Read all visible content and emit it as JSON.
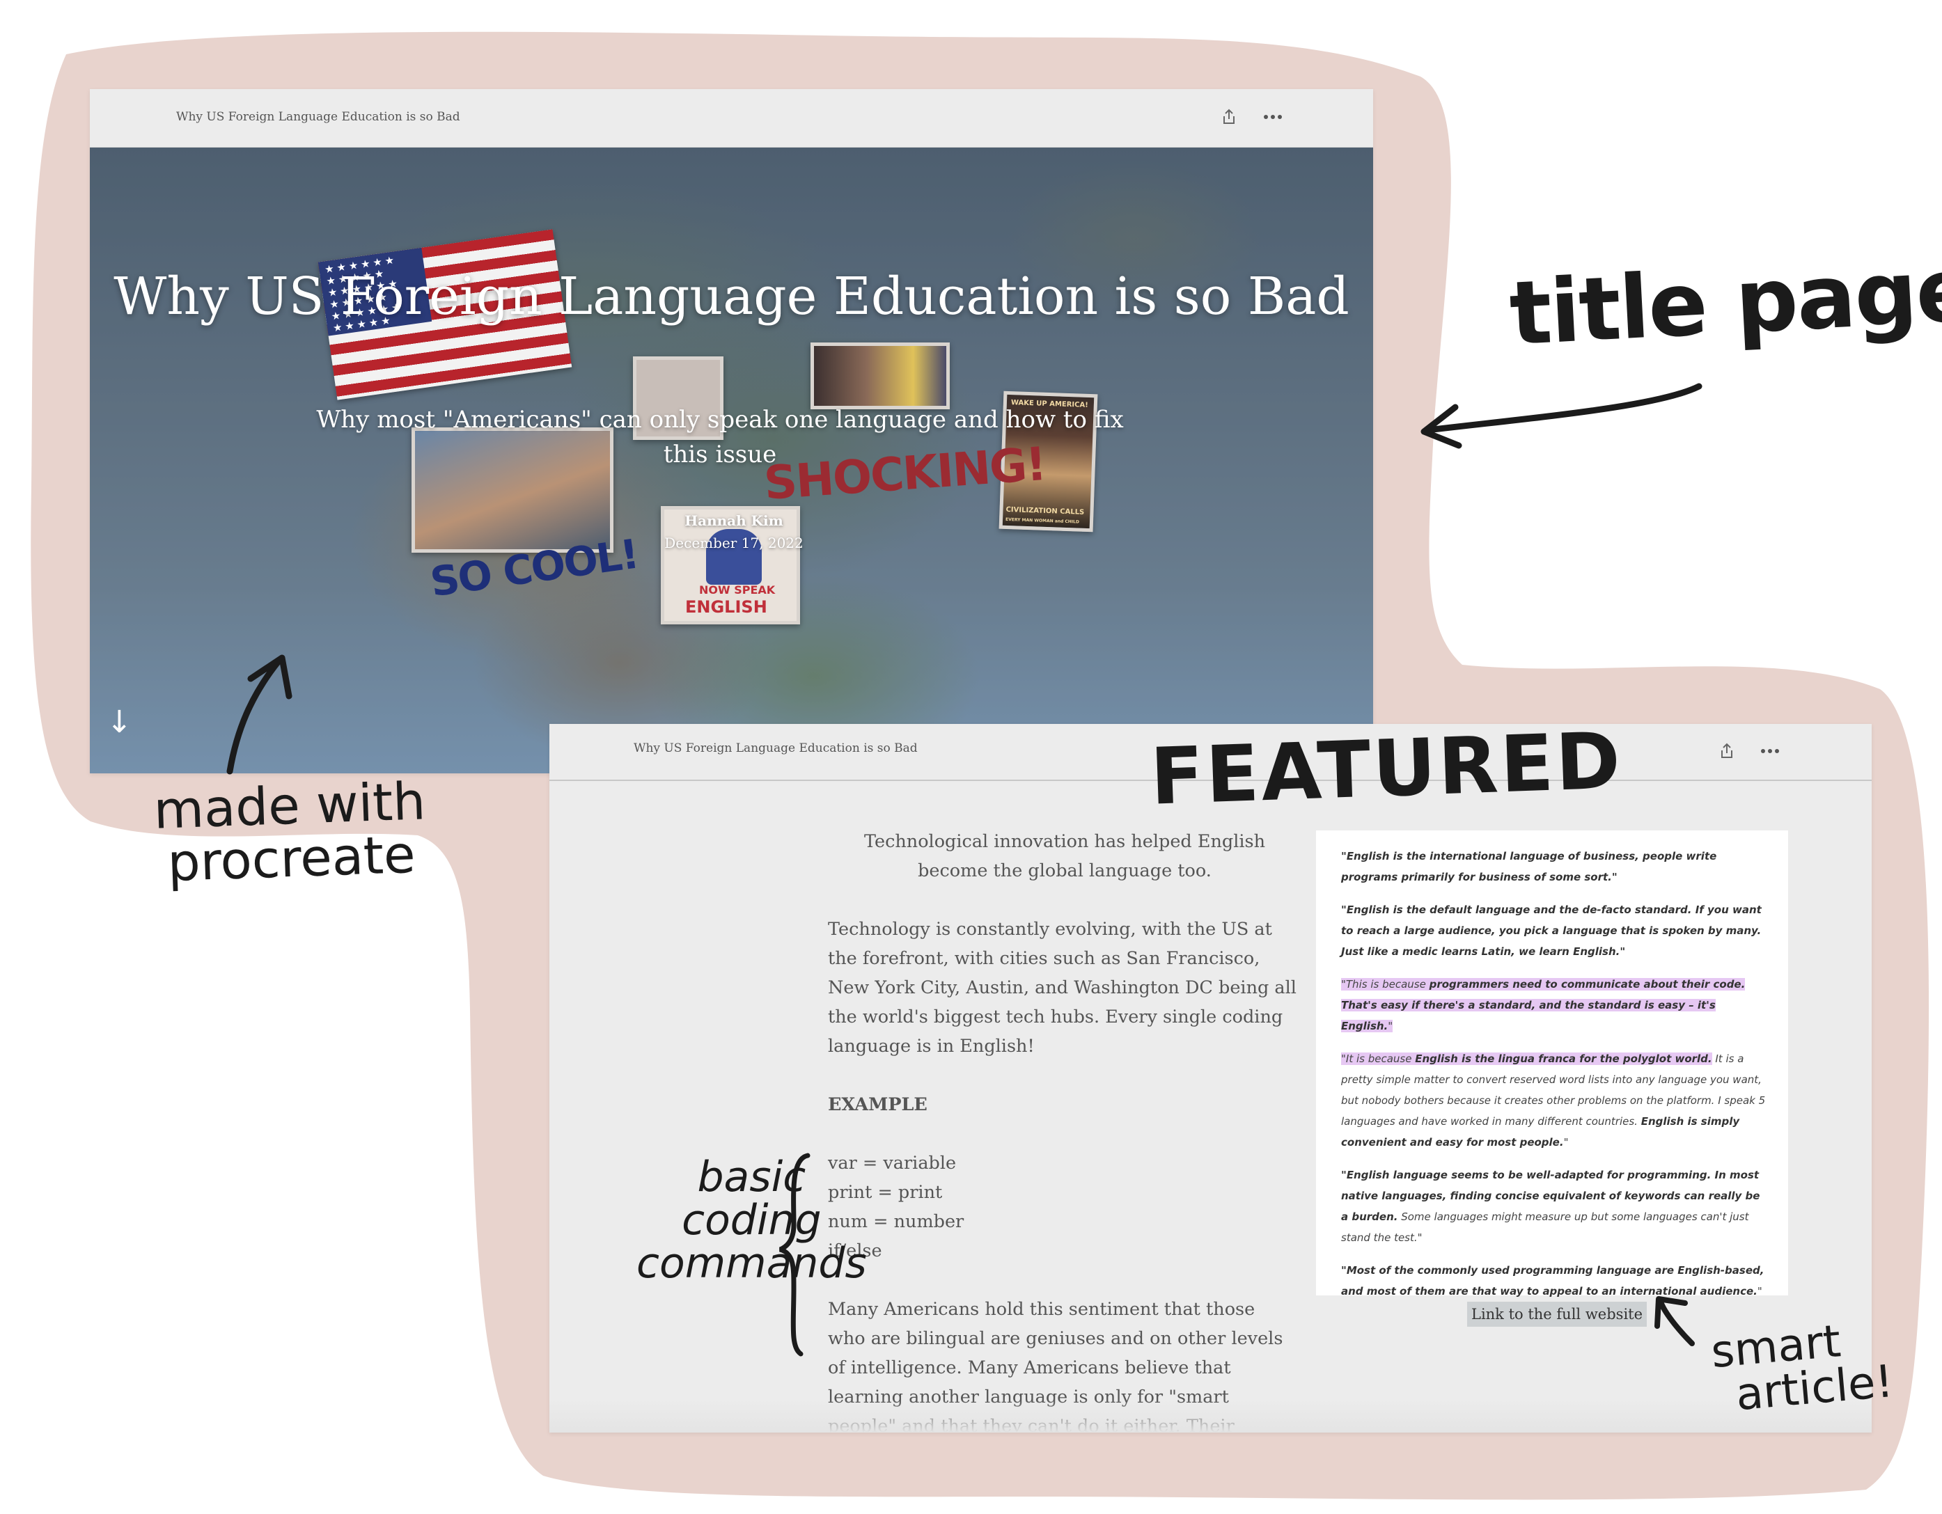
{
  "story_window": {
    "title": "Why US Foreign Language Education is so Bad",
    "share_icon": "share-icon",
    "more_icon": "more-horizontal-icon",
    "hero": {
      "title": "Why US Foreign Language Education is so Bad",
      "subtitle": "Why most \"Americans\" can only speak one language and how to fix this issue",
      "author": "Hannah Kim",
      "date": "December 17, 2022",
      "scroll_icon": "arrow-down-icon",
      "scroll_glyph": "↓"
    },
    "stickers": {
      "flag": "us-flag",
      "so_cool": "SO COOL!",
      "shocking": "SHOCKING!",
      "now_speak": "NOW SPEAK",
      "english": "ENGLISH",
      "wake_up": "WAKE UP AMERICA!",
      "civilization": "CIVILIZATION CALLS",
      "every_man": "EVERY MAN WOMAN and CHILD"
    }
  },
  "article_window": {
    "title": "Why US Foreign Language Education is so Bad",
    "share_icon": "share-icon",
    "more_icon": "more-horizontal-icon",
    "paragraphs": {
      "intro": "Technological innovation has helped English become the global language too.",
      "tech": "Technology is constantly evolving, with the US at the forefront, with cities such as San Francisco, New York City, Austin, and Washington DC being all the world's biggest tech hubs. Every single coding language is in English!",
      "example_heading": "EXAMPLE",
      "code_lines": [
        "var = variable",
        "print = print",
        "num = number",
        "if/else"
      ],
      "sentiment": "Many Americans hold this sentiment that those who are bilingual are geniuses and on other levels of intelligence. Many Americans believe that learning another language is only for \"smart people\" and that they can't do it either. Their underwhelming high school classes \"traumatized\" them from ever wanting to hear Spanish or French spoken"
    },
    "quotes": {
      "q1": "\"English is the international language of business, people write programs primarily for business of some sort.\"",
      "q2": "\"English is the default language and the de-facto standard. If you want to reach a large audience, you pick a language that is spoken by many. Just like a medic learns Latin, we learn English.\"",
      "q3_a": "\"This is because ",
      "q3_b": "programmers need to communicate about their code. That's easy if there's a standard, and the standard is easy – it's English.",
      "q3_c": "\"",
      "q4_a": "\"It is because ",
      "q4_b": "English is the lingua franca for the polyglot world.",
      "q4_c": " It is a pretty simple matter to convert reserved word lists into any language you want, but nobody bothers because it creates other problems on the platform. I speak 5 languages and have worked in many different countries. ",
      "q4_d": "English is simply convenient and easy for most people.",
      "q4_e": "\"",
      "q5_a": "\"English language seems to be well-adapted for programming. In most native languages, finding concise equivalent of keywords can really be a burden.",
      "q5_b": " Some languages might measure up but some languages can't just stand the test.\"",
      "q6_a": "\"Most of the commonly used programming language are English-based, and most of them are that way to appeal to an international audience.",
      "q6_b": "\""
    },
    "link_label": "Link to the full website"
  },
  "annotations": {
    "title_page": "title page",
    "made_with_1": "made with",
    "made_with_2": "procreate",
    "featured": "FEATURED",
    "coding_1": "basic",
    "coding_2": "coding",
    "coding_3": "commands",
    "smart_1": "smart",
    "smart_2": "article!"
  },
  "colors": {
    "blob": "#e8d3cd",
    "window": "#ececec",
    "highlight": "#e6c8f3",
    "ink": "#1b1b1b"
  }
}
